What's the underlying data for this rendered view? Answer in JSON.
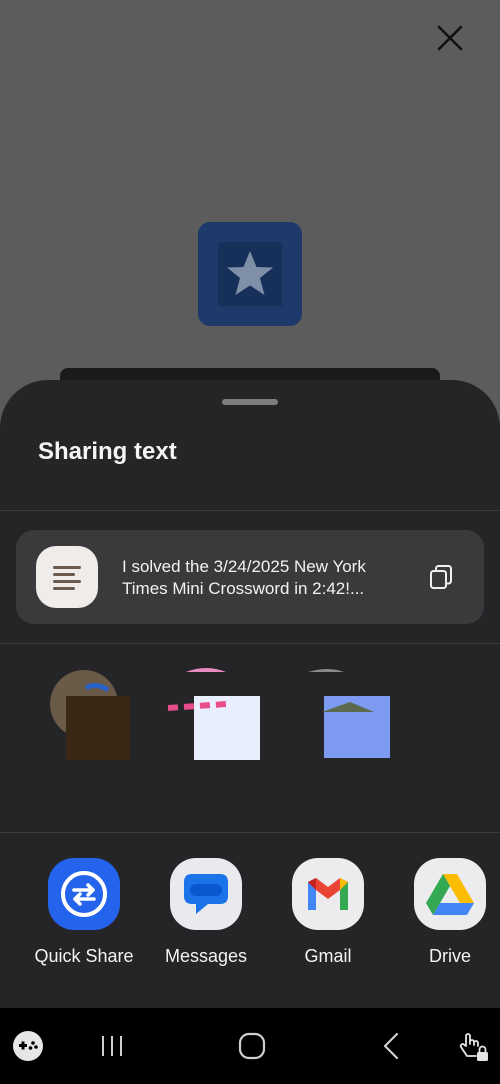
{
  "background_app": {
    "close_icon": "close-icon",
    "star_icon": "star-icon",
    "tile_color": "#1e3a6a"
  },
  "sheet": {
    "title": "Sharing text",
    "preview": {
      "icon": "text-document-icon",
      "text": "I solved the 3/24/2025 New York Times Mini Crossword in 2:42!...",
      "copy_icon": "copy-icon"
    },
    "contacts": [
      {
        "label": "",
        "icon": "contact-avatar"
      },
      {
        "label": "",
        "icon": "contact-avatar"
      },
      {
        "label": "",
        "icon": "contact-avatar"
      }
    ],
    "apps": [
      {
        "label": "Quick Share",
        "icon": "quick-share-icon",
        "color": "#2463eb"
      },
      {
        "label": "Messages",
        "icon": "messages-icon",
        "color": "#1a73e8"
      },
      {
        "label": "Gmail",
        "icon": "gmail-icon",
        "color": "#ea4335"
      },
      {
        "label": "Drive",
        "icon": "drive-icon",
        "color": "#34a853"
      }
    ]
  },
  "navbar": {
    "items": [
      "gamepad-icon",
      "recent-apps-icon",
      "home-icon",
      "back-icon",
      "touch-lock-icon"
    ]
  }
}
